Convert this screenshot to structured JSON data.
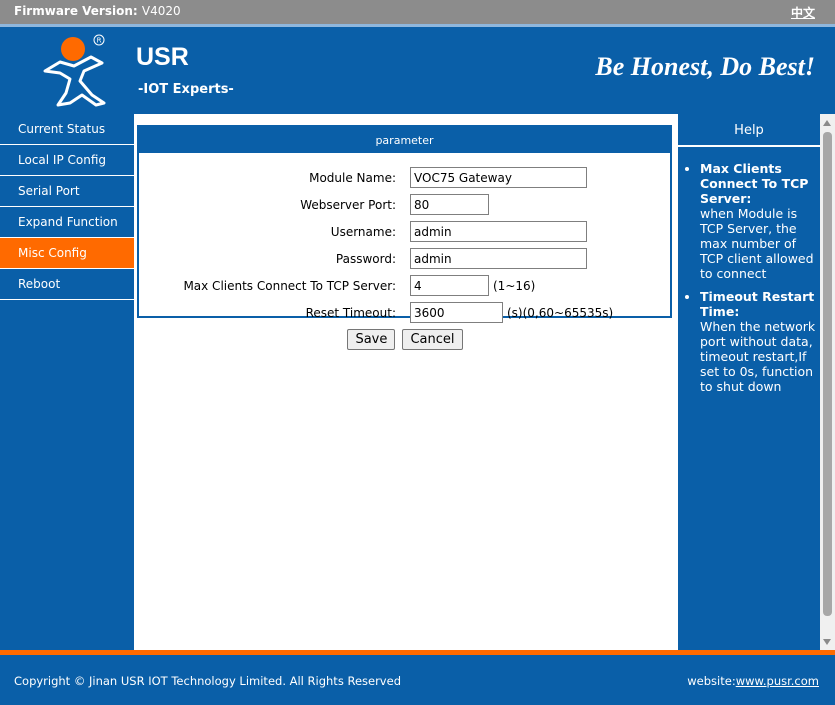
{
  "topbar": {
    "firmware_label": "Firmware Version:",
    "firmware_version": "V4020",
    "language_link": "中文"
  },
  "header": {
    "brand": "USR",
    "tagline": "-IOT Experts-",
    "motto": "Be Honest, Do Best!"
  },
  "sidebar": {
    "items": [
      {
        "label": "Current Status"
      },
      {
        "label": "Local IP Config"
      },
      {
        "label": "Serial Port"
      },
      {
        "label": "Expand Function"
      },
      {
        "label": "Misc Config",
        "active": true
      },
      {
        "label": "Reboot"
      }
    ]
  },
  "panel": {
    "title": "parameter",
    "fields": {
      "module_name": {
        "label": "Module Name:",
        "value": "VOC75 Gateway"
      },
      "webserver_port": {
        "label": "Webserver Port:",
        "value": "80"
      },
      "username": {
        "label": "Username:",
        "value": "admin"
      },
      "password": {
        "label": "Password:",
        "value": "admin"
      },
      "max_clients": {
        "label": "Max Clients Connect To TCP Server:",
        "value": "4",
        "unit": "(1~16)"
      },
      "reset_timeout": {
        "label": "Reset Timeout:",
        "value": "3600",
        "unit": "(s)(0,60~65535s)"
      }
    },
    "save_label": "Save",
    "cancel_label": "Cancel"
  },
  "help": {
    "title": "Help",
    "items": [
      {
        "term": "Max Clients Connect To TCP Server:",
        "desc": "when Module is TCP Server, the max number of TCP client allowed to connect"
      },
      {
        "term": "Timeout Restart Time:",
        "desc": "When the network port without data, timeout restart,If set to 0s, function to shut down"
      }
    ]
  },
  "footer": {
    "copyright": "Copyright © Jinan USR IOT Technology Limited. All Rights Reserved",
    "website_label": "website:",
    "website_link": "www.pusr.com"
  },
  "colors": {
    "primary_blue": "#0a5fa8",
    "accent_orange": "#ff6a00",
    "topbar_gray": "#8c8c8c"
  }
}
